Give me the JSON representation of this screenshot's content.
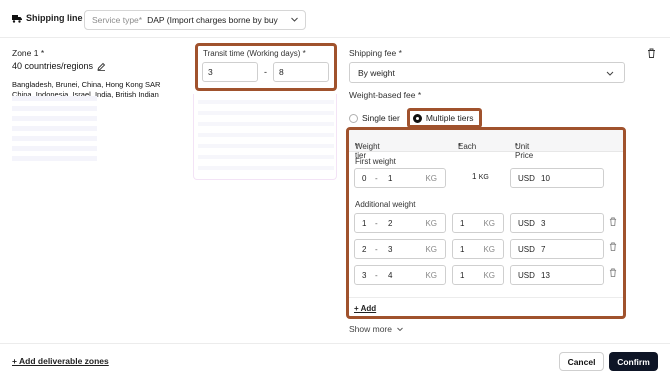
{
  "header": {
    "title": "Shipping line",
    "service_type_label": "Service type",
    "service_type_required": "*",
    "service_type_value": "DAP  (Import charges borne by buy"
  },
  "zone": {
    "label": "Zone 1",
    "required": "*",
    "count": "40 countries/regions",
    "countries_line1": "Bangladesh, Brunei, China, Hong Kong SAR",
    "countries_line2": "China, Indonesia, Israel, India, British Indian"
  },
  "transit": {
    "label": "Transit time (Working days)",
    "required": "*",
    "min": "3",
    "separator": "-",
    "max": "8"
  },
  "shipping_fee": {
    "label": "Shipping fee",
    "required": "*",
    "value": "By weight",
    "weight_based_label": "Weight-based fee",
    "single_tier_label": "Single tier",
    "multiple_tiers_label": "Multiple tiers",
    "selected": "multiple"
  },
  "tiers": {
    "col_weight_tier": "Weight tier",
    "col_each": "Each",
    "col_unit_price": "Unit Price",
    "required": "*",
    "first_weight_label": "First weight",
    "first": {
      "from": "0",
      "to": "1",
      "unit": "KG",
      "each": "1",
      "each_unit": "KG",
      "currency": "USD",
      "price": "10"
    },
    "additional_weight_label": "Additional weight",
    "additional": [
      {
        "from": "1",
        "to": "2",
        "unit": "KG",
        "each": "1",
        "each_unit": "KG",
        "currency": "USD",
        "price": "3"
      },
      {
        "from": "2",
        "to": "3",
        "unit": "KG",
        "each": "1",
        "each_unit": "KG",
        "currency": "USD",
        "price": "7"
      },
      {
        "from": "3",
        "to": "4",
        "unit": "KG",
        "each": "1",
        "each_unit": "KG",
        "currency": "USD",
        "price": "13"
      }
    ],
    "add_label": "+ Add",
    "dash": "-"
  },
  "show_more": "Show more",
  "footer": {
    "add_zones": "+ Add deliverable zones",
    "cancel": "Cancel",
    "confirm": "Confirm"
  },
  "colors": {
    "highlight": "#a0522d",
    "confirm_bg": "#0e1526"
  },
  "icons": [
    "truck-icon",
    "chevron-down-icon",
    "edit-pencil-icon",
    "trash-icon"
  ]
}
